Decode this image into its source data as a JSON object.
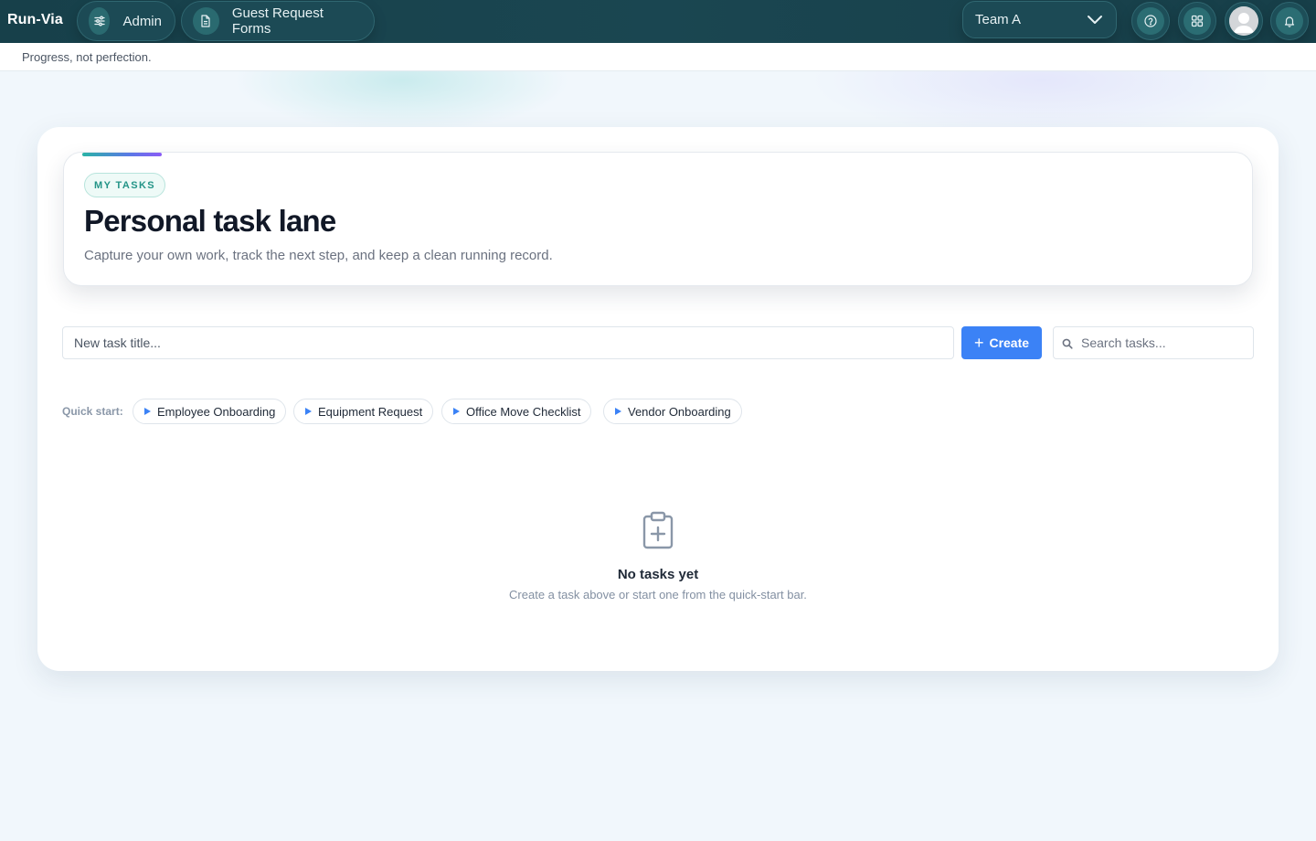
{
  "app": {
    "brand": "Run-Via"
  },
  "nav": {
    "admin_label": "Admin",
    "forms_label": "Guest Request Forms",
    "team_selected": "Team A"
  },
  "tagline": "Progress, not perfection.",
  "hero": {
    "tag": "MY TASKS",
    "title": "Personal task lane",
    "subtitle": "Capture your own work, track the next step, and keep a clean running record."
  },
  "task_form": {
    "title_placeholder": "New task title...",
    "create_label": "Create",
    "search_placeholder": "Search tasks..."
  },
  "quick_start": {
    "label": "Quick start:",
    "items": [
      {
        "label": "Employee Onboarding"
      },
      {
        "label": "Equipment Request"
      },
      {
        "label": "Office Move Checklist"
      },
      {
        "label": "Vendor Onboarding"
      }
    ]
  },
  "empty_state": {
    "title": "No tasks yet",
    "subtitle": "Create a task above or start one from the quick-start bar."
  },
  "icons": {
    "admin": "sliders-icon",
    "forms": "document-icon",
    "team": "chevron-down-icon",
    "help": "help-circle-icon",
    "apps": "apps-grid-icon",
    "avatar": "user-avatar-icon",
    "bell": "bell-icon",
    "search": "search-icon",
    "play": "play-icon",
    "empty": "clipboard-plus-icon"
  },
  "colors": {
    "topbar": "#1a4651",
    "primary": "#3b82f6",
    "accent_teal": "#2ab3a6",
    "accent_purple": "#8b5cf6"
  }
}
